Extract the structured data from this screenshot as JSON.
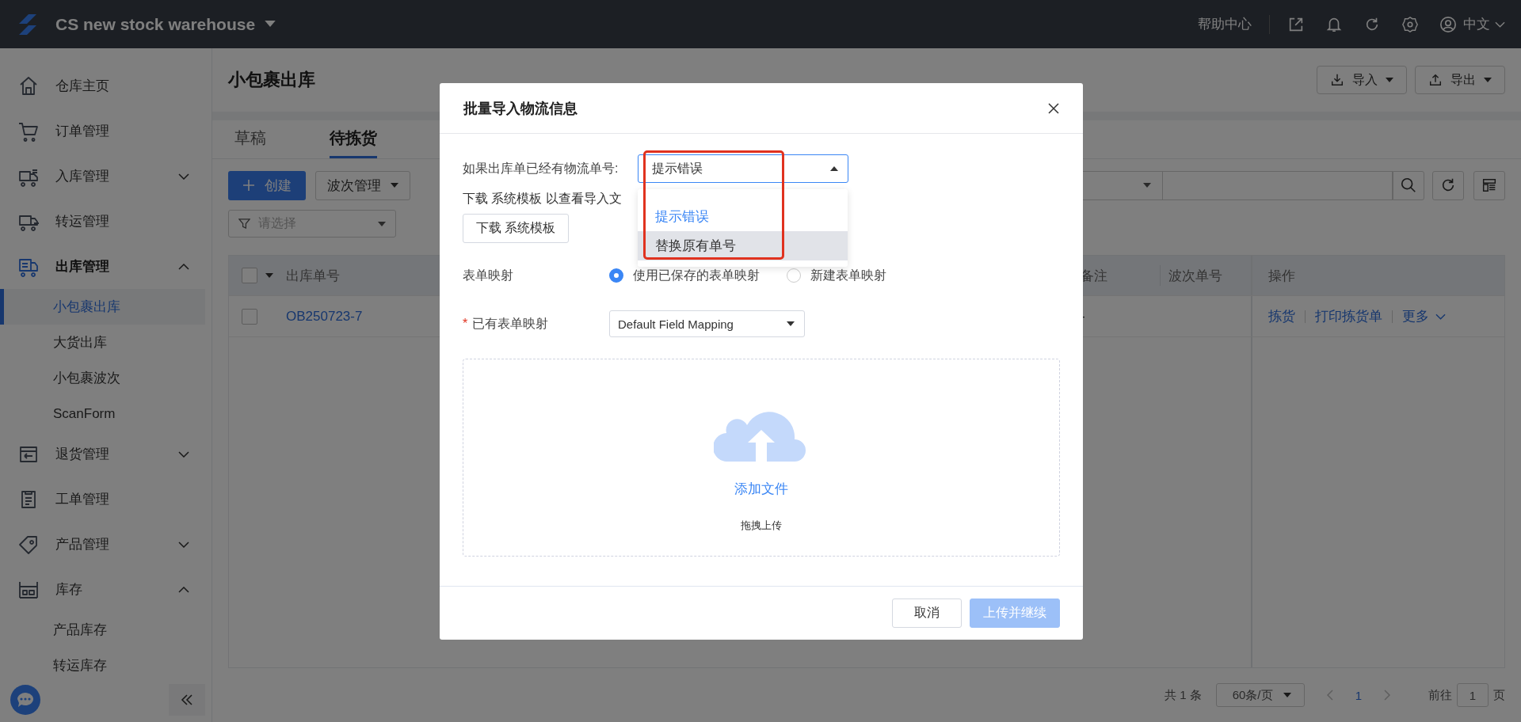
{
  "app": {
    "title": "CS new stock warehouse"
  },
  "top_bar": {
    "help": "帮助中心",
    "language": "中文"
  },
  "sidebar": {
    "items": [
      {
        "label": "仓库主页",
        "kind": "link",
        "active": false
      },
      {
        "label": "订单管理",
        "kind": "link",
        "active": false
      },
      {
        "label": "入库管理",
        "kind": "group",
        "active": false,
        "expanded": false
      },
      {
        "label": "转运管理",
        "kind": "link",
        "active": false
      },
      {
        "label": "出库管理",
        "kind": "group",
        "active": true,
        "expanded": true,
        "children": [
          {
            "label": "小包裹出库",
            "selected": true
          },
          {
            "label": "大货出库",
            "selected": false
          },
          {
            "label": "小包裹波次",
            "selected": false
          },
          {
            "label": "ScanForm",
            "selected": false
          }
        ]
      },
      {
        "label": "退货管理",
        "kind": "group",
        "active": false,
        "expanded": false
      },
      {
        "label": "工单管理",
        "kind": "link",
        "active": false
      },
      {
        "label": "产品管理",
        "kind": "group",
        "active": false,
        "expanded": false
      },
      {
        "label": "库存",
        "kind": "group",
        "active": false,
        "expanded": true,
        "children": [
          {
            "label": "产品库存",
            "selected": false
          },
          {
            "label": "转运库存",
            "selected": false
          }
        ]
      }
    ]
  },
  "page": {
    "title": "小包裹出库",
    "actions": [
      {
        "label": "导入"
      },
      {
        "label": "导出"
      }
    ]
  },
  "tabs": [
    {
      "label": "草稿",
      "selected": false
    },
    {
      "label": "待拣货",
      "selected": true
    }
  ],
  "toolbar": {
    "create": "创建",
    "batch": "波次管理"
  },
  "filter": {
    "placeholder": "请选择"
  },
  "table": {
    "select_all_checked": false,
    "columns": [
      {
        "label": "出库单号"
      },
      {
        "label": "备注"
      },
      {
        "label": "波次单号"
      },
      {
        "label": "操作"
      }
    ],
    "rows": [
      {
        "checked": false,
        "order_no": "OB250723-7",
        "note": "-",
        "actions": [
          "拣货",
          "打印拣货单",
          "更多"
        ]
      }
    ]
  },
  "pagination": {
    "total": "共 1 条",
    "page_size": "60条/页",
    "current": "1",
    "goto_label": "前往",
    "goto_value": "1",
    "page_suffix": "页"
  },
  "modal": {
    "title": "批量导入物流信息",
    "existing_label": "如果出库单已经有物流单号:",
    "existing_value": "提示错误",
    "dropdown": {
      "open": true,
      "options": [
        {
          "label": "提示错误",
          "selected": true,
          "highlighted": false
        },
        {
          "label": "替换原有单号",
          "selected": false,
          "highlighted": true
        }
      ]
    },
    "template_hint": "下载 系统模板 以查看导入文",
    "template_button": "下载 系统模板",
    "mapping": {
      "label": "表单映射",
      "options": [
        {
          "label": "使用已保存的表单映射",
          "selected": true
        },
        {
          "label": "新建表单映射",
          "selected": false
        }
      ]
    },
    "existing_mapping": {
      "required_mark": "*",
      "label": "已有表单映射",
      "value": "Default Field Mapping"
    },
    "upload": {
      "action": "添加文件",
      "hint": "拖拽上传"
    },
    "buttons": [
      {
        "label": "取消",
        "kind": "secondary",
        "disabled": false
      },
      {
        "label": "上传并继续",
        "kind": "primary",
        "disabled": true
      }
    ]
  }
}
